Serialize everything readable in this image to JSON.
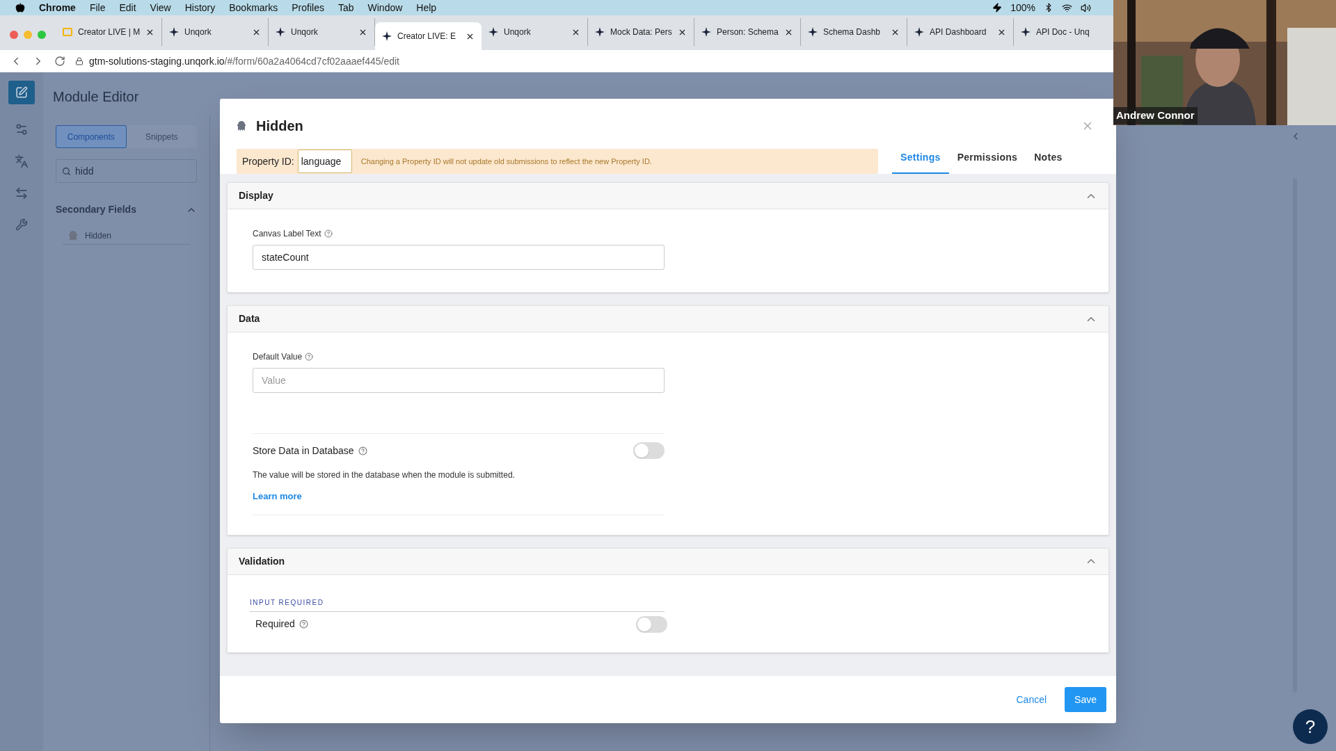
{
  "menu_bar": {
    "app": "Chrome",
    "items": [
      "File",
      "Edit",
      "View",
      "History",
      "Bookmarks",
      "Profiles",
      "Tab",
      "Window",
      "Help"
    ],
    "battery": "100%"
  },
  "browser_tabs": [
    {
      "title": "Creator LIVE | M",
      "kind": "slides",
      "selected": false
    },
    {
      "title": "Unqork",
      "kind": "app",
      "selected": false
    },
    {
      "title": "Unqork",
      "kind": "app",
      "selected": false
    },
    {
      "title": "Creator LIVE: E",
      "kind": "app",
      "selected": true
    },
    {
      "title": "Unqork",
      "kind": "app",
      "selected": false
    },
    {
      "title": "Mock Data: Pers",
      "kind": "app",
      "selected": false
    },
    {
      "title": "Person: Schema",
      "kind": "app",
      "selected": false
    },
    {
      "title": "Schema Dashb",
      "kind": "app",
      "selected": false
    },
    {
      "title": "API Dashboard",
      "kind": "app",
      "selected": false
    },
    {
      "title": "API Doc - Unq",
      "kind": "app",
      "selected": false
    }
  ],
  "address_bar": {
    "host": "gtm-solutions-staging.unqork.io",
    "path": "/#/form/60a2a4064cd7cf02aaaef445/edit"
  },
  "page": {
    "title": "Module Editor",
    "sidebar_tabs": [
      {
        "label": "Components",
        "selected": true
      },
      {
        "label": "Snippets",
        "selected": false
      }
    ],
    "search": {
      "value": "hidd"
    },
    "group": {
      "title": "Secondary Fields",
      "expanded": true,
      "items": [
        "Hidden"
      ]
    }
  },
  "modal": {
    "title": "Hidden",
    "property_id": {
      "label": "Property ID:",
      "value": "language"
    },
    "warning": "Changing a Property ID will not update old submissions to reflect the new Property ID.",
    "tabs": [
      {
        "label": "Settings",
        "selected": true
      },
      {
        "label": "Permissions",
        "selected": false
      },
      {
        "label": "Notes",
        "selected": false
      }
    ],
    "sections": [
      {
        "title": "Display",
        "expanded": true,
        "fields": [
          {
            "kind": "text",
            "label": "Canvas Label Text",
            "value": "stateCount"
          }
        ]
      },
      {
        "title": "Data",
        "expanded": true,
        "fields": [
          {
            "kind": "text",
            "label": "Default Value",
            "placeholder": "Value"
          },
          {
            "kind": "toggle",
            "label": "Store Data in Database",
            "on": false,
            "description": "The value will be stored in the database when the module is submitted.",
            "link": "Learn more"
          }
        ]
      },
      {
        "title": "Validation",
        "expanded": true,
        "group_label": "INPUT REQUIRED",
        "fields": [
          {
            "kind": "toggle",
            "label": "Required",
            "on": false
          }
        ]
      }
    ],
    "buttons": [
      "Cancel",
      "Save"
    ]
  },
  "video_overlay": {
    "name": "Andrew Connor"
  },
  "help_button": "?"
}
